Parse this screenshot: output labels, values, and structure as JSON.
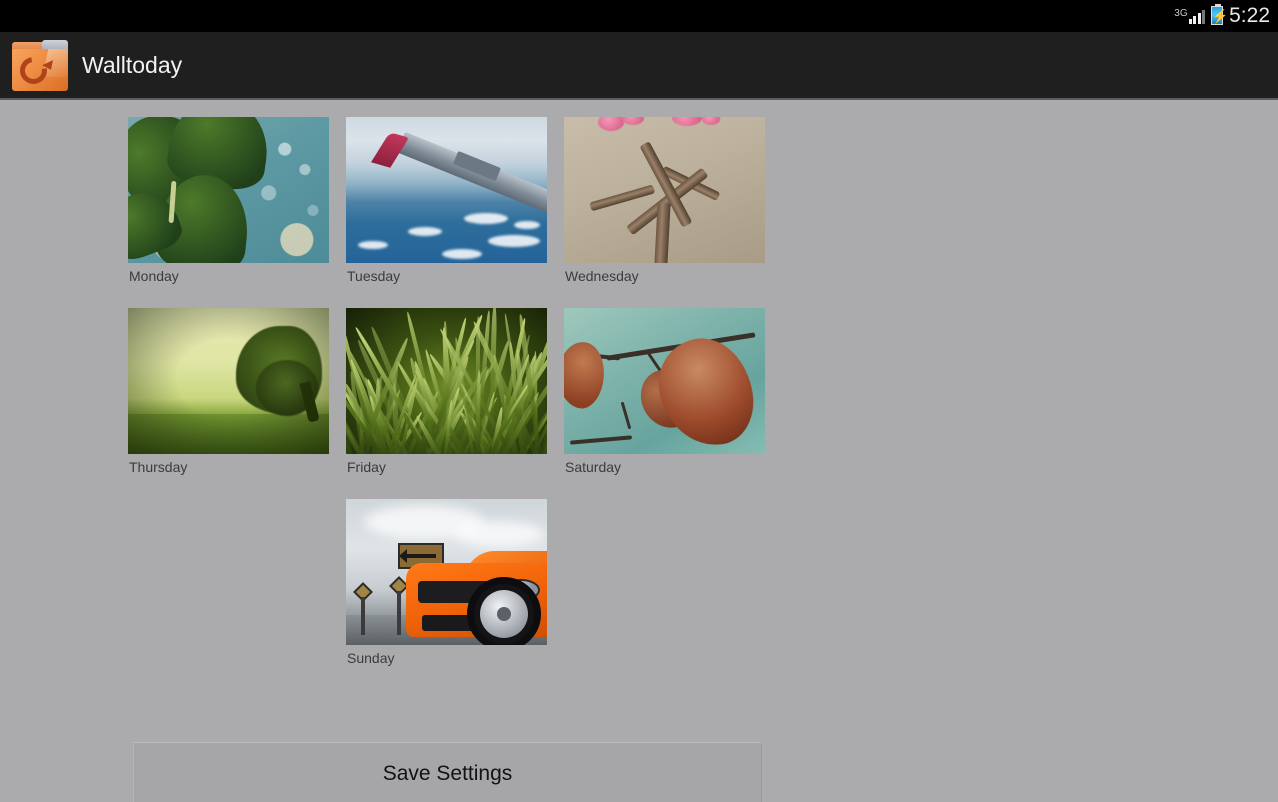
{
  "status_bar": {
    "network_label": "3G",
    "signal_icon": "signal-bars-icon",
    "battery_icon": "battery-charging-icon",
    "battery_bolt": "⚡",
    "time": "5:22"
  },
  "action_bar": {
    "app_icon": "orange-folder-recycle-icon",
    "title": "Walltoday"
  },
  "days": [
    {
      "label": "Monday",
      "thumbnail": "clover-water-drops"
    },
    {
      "label": "Tuesday",
      "thumbnail": "airplane-wing-over-ocean"
    },
    {
      "label": "Wednesday",
      "thumbnail": "branch-with-pink-blossoms"
    },
    {
      "label": "Thursday",
      "thumbnail": "lone-tree-green-field"
    },
    {
      "label": "Friday",
      "thumbnail": "green-grass-blades"
    },
    {
      "label": "Saturday",
      "thumbnail": "autumn-leaf-on-teal"
    },
    {
      "label": "Sunday",
      "thumbnail": "orange-muscle-car"
    }
  ],
  "save_button": {
    "label": "Save Settings"
  },
  "colors": {
    "status_bar_bg": "#000000",
    "action_bar_bg": "#1f1f1f",
    "action_bar_divider": "#5c5c5c",
    "content_bg": "#ababae",
    "title_text": "#f2f2f2",
    "day_label_text": "#3b3b3b",
    "button_bg": "#a6a6a9",
    "button_text": "#121212",
    "accent_orange": "#ef8f45"
  }
}
